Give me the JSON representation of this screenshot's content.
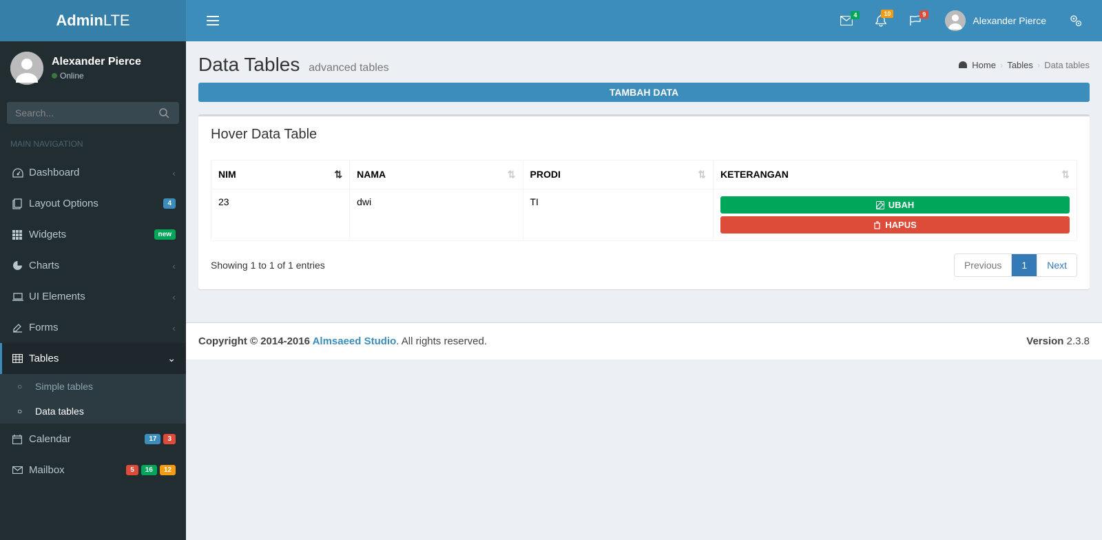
{
  "brand": {
    "bold": "Admin",
    "light": "LTE"
  },
  "header": {
    "user_name": "Alexander Pierce",
    "badges": {
      "mail": "4",
      "bell": "10",
      "flag": "9"
    }
  },
  "sidebar": {
    "user": {
      "name": "Alexander Pierce",
      "status": "Online"
    },
    "search": {
      "placeholder": "Search..."
    },
    "section": "MAIN NAVIGATION",
    "items": [
      {
        "label": "Dashboard",
        "arrow": true
      },
      {
        "label": "Layout Options",
        "badge": "4",
        "badge_class": "label-blue"
      },
      {
        "label": "Widgets",
        "badge": "new",
        "badge_class": "label-green"
      },
      {
        "label": "Charts",
        "arrow": true
      },
      {
        "label": "UI Elements",
        "arrow": true
      },
      {
        "label": "Forms",
        "arrow": true
      },
      {
        "label": "Tables",
        "arrow": true,
        "active": true
      },
      {
        "label": "Calendar"
      },
      {
        "label": "Mailbox"
      }
    ],
    "tables_sub": [
      {
        "label": "Simple tables"
      },
      {
        "label": "Data tables",
        "active": true
      }
    ],
    "calendar_badges": [
      "17",
      "3"
    ],
    "mailbox_badges": [
      "5",
      "16",
      "12"
    ]
  },
  "page": {
    "title": "Data Tables",
    "subtitle": "advanced tables",
    "breadcrumb": {
      "home": "Home",
      "parent": "Tables",
      "current": "Data tables"
    },
    "callout": "TAMBAH DATA",
    "box_title": "Hover Data Table",
    "columns": [
      "NIM",
      "NAMA",
      "PRODI",
      "KETERANGAN"
    ],
    "rows": [
      {
        "nim": "23",
        "nama": "dwi",
        "prodi": "TI"
      }
    ],
    "actions": {
      "edit": "UBAH",
      "delete": "HAPUS"
    },
    "info": "Showing 1 to 1 of 1 entries",
    "pagination": {
      "prev": "Previous",
      "current": "1",
      "next": "Next"
    }
  },
  "footer": {
    "copyright": "Copyright © 2014-2016 ",
    "studio": "Almsaeed Studio",
    "rights": ". All rights reserved.",
    "version_label": "Version",
    "version": " 2.3.8"
  }
}
